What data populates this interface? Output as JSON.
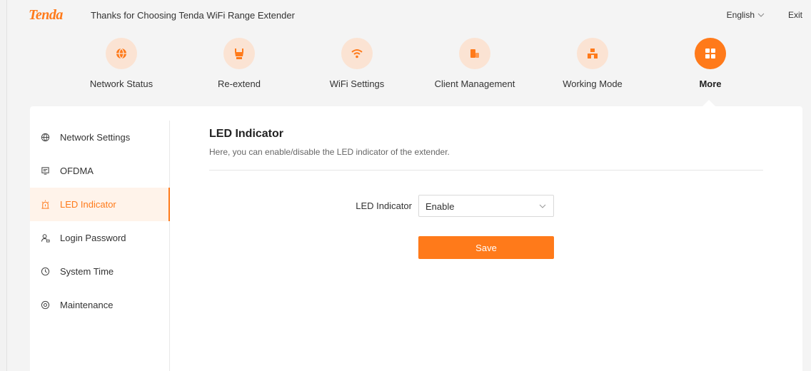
{
  "header": {
    "logo": "Tenda",
    "slogan": "Thanks for Choosing Tenda WiFi Range Extender",
    "language": "English",
    "exit": "Exit"
  },
  "nav": {
    "items": [
      {
        "label": "Network Status",
        "icon": "globe-icon"
      },
      {
        "label": "Re-extend",
        "icon": "extender-icon"
      },
      {
        "label": "WiFi Settings",
        "icon": "wifi-icon"
      },
      {
        "label": "Client Management",
        "icon": "clients-icon"
      },
      {
        "label": "Working Mode",
        "icon": "mode-icon"
      },
      {
        "label": "More",
        "icon": "grid-icon",
        "active": true
      }
    ]
  },
  "sidebar": {
    "items": [
      {
        "label": "Network Settings",
        "icon": "globe-icon"
      },
      {
        "label": "OFDMA",
        "icon": "ofdma-icon"
      },
      {
        "label": "LED Indicator",
        "icon": "led-icon",
        "active": true
      },
      {
        "label": "Login Password",
        "icon": "user-lock-icon"
      },
      {
        "label": "System Time",
        "icon": "clock-icon"
      },
      {
        "label": "Maintenance",
        "icon": "maintenance-icon"
      }
    ]
  },
  "main": {
    "title": "LED Indicator",
    "description": "Here, you can enable/disable the LED indicator of the extender.",
    "led_label": "LED Indicator",
    "led_value": "Enable",
    "save_label": "Save"
  },
  "colors": {
    "accent": "#ff7a1a",
    "accent_light": "#fbe3d3",
    "active_bg": "#fff3ea"
  }
}
